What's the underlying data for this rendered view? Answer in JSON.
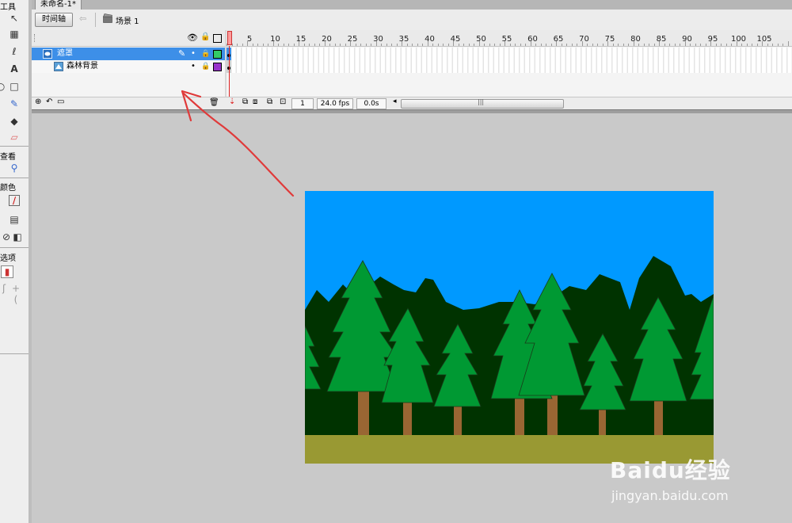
{
  "toolbox": {
    "tools_label": "工具",
    "view_label": "查看",
    "colors_label": "颜色",
    "options_label": "选项"
  },
  "document": {
    "tab_title": "未命名-1*"
  },
  "scene_bar": {
    "timeline_button": "时间轴",
    "scene_label": "场景 1"
  },
  "timeline": {
    "frame_numbers": [
      "5",
      "10",
      "15",
      "20",
      "25",
      "30",
      "35",
      "40",
      "45",
      "50",
      "55",
      "60",
      "65",
      "70",
      "75",
      "80",
      "85",
      "90",
      "95",
      "100",
      "105"
    ],
    "layers": [
      {
        "name": "遮罩",
        "selected": true,
        "color": "#33cc66"
      },
      {
        "name": "森林背景",
        "selected": false,
        "color": "#9933cc"
      }
    ],
    "current_frame": "1",
    "frame_rate": "24.0 fps",
    "elapsed_time": "0.0s"
  },
  "colors": {
    "sky": "#0099ff",
    "ground": "#999933",
    "dark_forest": "#003300",
    "tree_green": "#009933",
    "trunk": "#996633",
    "selection": "#3d8fe8",
    "annotation_arrow": "#e03a3a"
  },
  "watermark": {
    "logo_text": "Baidu经验",
    "url": "jingyan.baidu.com"
  }
}
